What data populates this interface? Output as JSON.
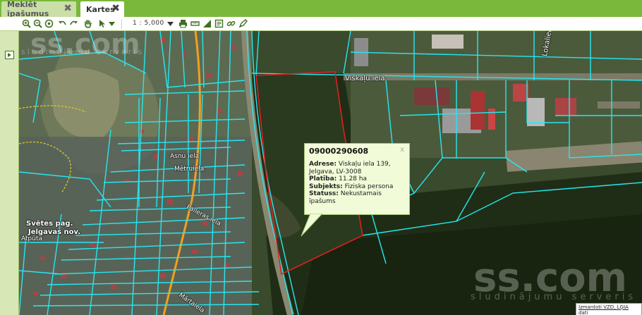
{
  "tabs": [
    {
      "label": "Meklēt īpašumus",
      "active": false
    },
    {
      "label": "Kartes",
      "active": true
    }
  ],
  "toolbar": {
    "icons": [
      "zoom-in-icon",
      "zoom-out-icon",
      "zoom-extent-icon",
      "undo-icon",
      "redo-icon",
      "pan-hand-icon",
      "select-pointer-icon",
      "dropdown-icon",
      "print-icon",
      "measure-length-icon",
      "measure-area-icon",
      "identify-icon",
      "link-icon",
      "draw-icon"
    ],
    "scale_value": "1 : 5,000"
  },
  "map": {
    "street_labels": {
      "viskalu": "Viskaļu iela",
      "lokalela": "Lokaliela",
      "asnu": "Asnu iela",
      "metru": "Mētruiela",
      "palleras": "Palleras iela",
      "marta": "Mārtaiela",
      "atputa": "Atpūta",
      "svetes": "Svētes pag.",
      "jelgavas": "Jelgavas nov."
    },
    "watermark": {
      "main": "ss.com",
      "sub": "sludinājumu serveris"
    },
    "attribution": "Izmantoti VZD, LĢIA dati",
    "colors": {
      "parcel": "#25e8f0",
      "selected": "#e02020",
      "road": "#f0a020",
      "boundary": "#e8d020"
    }
  },
  "popup": {
    "id": "09000290608",
    "close": "x",
    "address_label": "Adrese:",
    "address": "Viskaļu iela 139, Jelgava, LV-3008",
    "area_label": "Platība:",
    "area": "11.28 ha",
    "subject_label": "Subjekts:",
    "subject": "Fiziska persona",
    "status_label": "Statuss:",
    "status": "Nekustamais īpašums"
  }
}
